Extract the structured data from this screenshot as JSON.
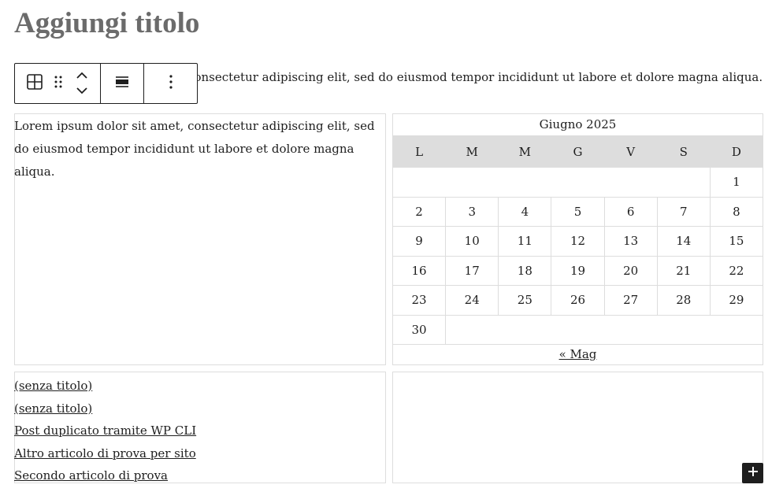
{
  "post_title_placeholder": "Aggiungi titolo",
  "intro_paragraph": "Lorem ipsum dolor sit amet, consectetur adipiscing elit, sed do eiusmod tempor incididunt ut labore et dolore magna aliqua.",
  "column_paragraph": "Lorem ipsum dolor sit amet, consectetur adipiscing elit, sed do eiusmod tempor incididunt ut labore et dolore magna aliqua.",
  "toolbar": {
    "icons": [
      "table-icon",
      "drag-handle-icon",
      "move-up-icon",
      "move-down-icon",
      "align-icon",
      "more-options-icon"
    ]
  },
  "calendar": {
    "caption": "Giugno 2025",
    "weekdays": [
      "L",
      "M",
      "M",
      "G",
      "V",
      "S",
      "D"
    ],
    "weeks": [
      [
        "",
        "",
        "",
        "",
        "",
        "",
        "1"
      ],
      [
        "2",
        "3",
        "4",
        "5",
        "6",
        "7",
        "8"
      ],
      [
        "9",
        "10",
        "11",
        "12",
        "13",
        "14",
        "15"
      ],
      [
        "16",
        "17",
        "18",
        "19",
        "20",
        "21",
        "22"
      ],
      [
        "23",
        "24",
        "25",
        "26",
        "27",
        "28",
        "29"
      ],
      [
        "30"
      ]
    ],
    "prev_link": "« Mag"
  },
  "latest_posts": [
    "(senza titolo)",
    "(senza titolo)",
    "Post duplicato tramite WP CLI",
    "Altro articolo di prova per sito",
    "Secondo articolo di prova"
  ],
  "colors": {
    "text": "#1e1e1e",
    "title": "#6b6b6b",
    "border": "#dddddd",
    "header_bg": "#dddddd"
  }
}
